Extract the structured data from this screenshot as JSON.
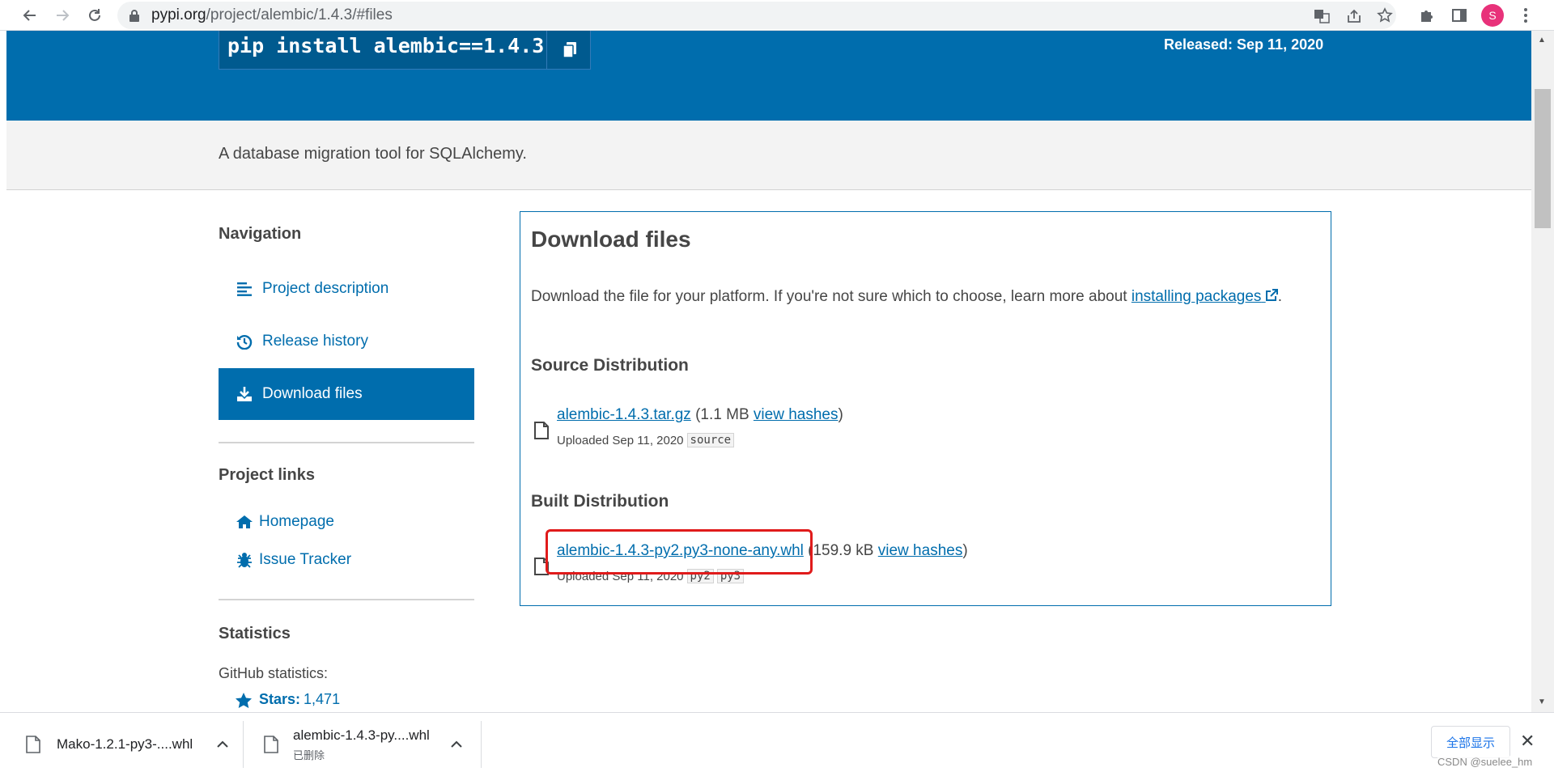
{
  "browser": {
    "url_host": "pypi.org",
    "url_path": "/project/alembic/1.4.3/#files",
    "avatar_letter": "S"
  },
  "hero": {
    "pip_command": "pip install alembic==1.4.3",
    "released": "Released: Sep 11, 2020"
  },
  "summary": "A database migration tool for SQLAlchemy.",
  "sidebar": {
    "navigation_heading": "Navigation",
    "nav_items": [
      {
        "label": "Project description",
        "icon": "align-left-icon"
      },
      {
        "label": "Release history",
        "icon": "history-icon"
      },
      {
        "label": "Download files",
        "icon": "download-icon",
        "active": true
      }
    ],
    "project_links_heading": "Project links",
    "project_links": [
      {
        "label": "Homepage",
        "icon": "home-icon"
      },
      {
        "label": "Issue Tracker",
        "icon": "bug-icon"
      }
    ],
    "statistics_heading": "Statistics",
    "github_stats_label": "GitHub statistics:",
    "stars_label": "Stars:",
    "stars_count": "1,471"
  },
  "files": {
    "title": "Download files",
    "intro_text": "Download the file for your platform. If you're not sure which to choose, learn more about ",
    "intro_link": "installing packages",
    "intro_end": ".",
    "source_heading": "Source Distribution",
    "source_file": {
      "name": "alembic-1.4.3.tar.gz",
      "size": "(1.1 MB",
      "hashes": "view hashes",
      "close": ")",
      "uploaded": "Uploaded Sep 11, 2020",
      "tags": [
        "source"
      ]
    },
    "built_heading": "Built Distribution",
    "built_file": {
      "name": "alembic-1.4.3-py2.py3-none-any.whl",
      "size": "(159.9 kB",
      "hashes": "view hashes",
      "close": ")",
      "uploaded": "Uploaded Sep 11, 2020",
      "tags": [
        "py2",
        "py3"
      ]
    }
  },
  "downloads_shelf": {
    "items": [
      {
        "name": "Mako-1.2.1-py3-....whl",
        "status": ""
      },
      {
        "name": "alembic-1.4.3-py....whl",
        "status": "已删除"
      }
    ],
    "show_all": "全部显示"
  },
  "watermark": "CSDN @suelee_hm",
  "colors": {
    "brand_blue": "#006dad",
    "highlight_red": "#e01b1b"
  }
}
